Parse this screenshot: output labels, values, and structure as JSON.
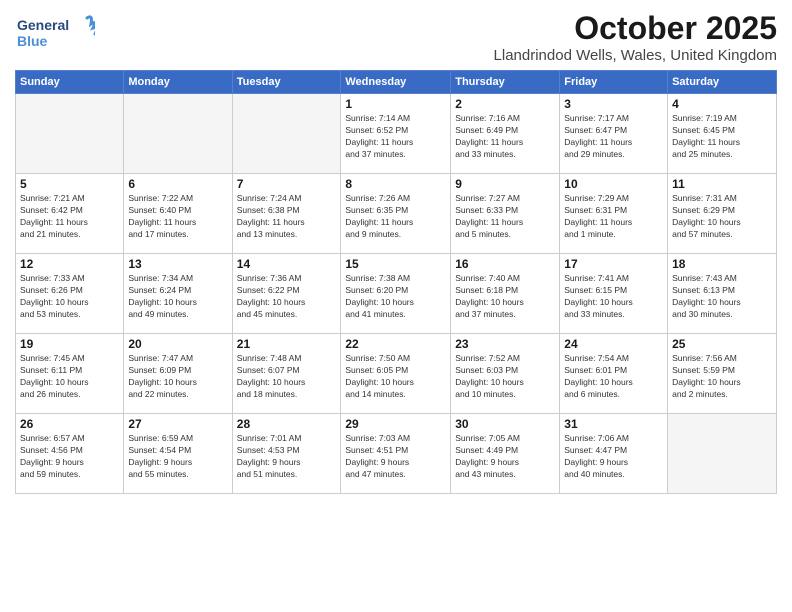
{
  "header": {
    "logo_general": "General",
    "logo_blue": "Blue",
    "month_year": "October 2025",
    "location": "Llandrindod Wells, Wales, United Kingdom"
  },
  "weekdays": [
    "Sunday",
    "Monday",
    "Tuesday",
    "Wednesday",
    "Thursday",
    "Friday",
    "Saturday"
  ],
  "weeks": [
    [
      {
        "day": "",
        "info": ""
      },
      {
        "day": "",
        "info": ""
      },
      {
        "day": "",
        "info": ""
      },
      {
        "day": "1",
        "info": "Sunrise: 7:14 AM\nSunset: 6:52 PM\nDaylight: 11 hours\nand 37 minutes."
      },
      {
        "day": "2",
        "info": "Sunrise: 7:16 AM\nSunset: 6:49 PM\nDaylight: 11 hours\nand 33 minutes."
      },
      {
        "day": "3",
        "info": "Sunrise: 7:17 AM\nSunset: 6:47 PM\nDaylight: 11 hours\nand 29 minutes."
      },
      {
        "day": "4",
        "info": "Sunrise: 7:19 AM\nSunset: 6:45 PM\nDaylight: 11 hours\nand 25 minutes."
      }
    ],
    [
      {
        "day": "5",
        "info": "Sunrise: 7:21 AM\nSunset: 6:42 PM\nDaylight: 11 hours\nand 21 minutes."
      },
      {
        "day": "6",
        "info": "Sunrise: 7:22 AM\nSunset: 6:40 PM\nDaylight: 11 hours\nand 17 minutes."
      },
      {
        "day": "7",
        "info": "Sunrise: 7:24 AM\nSunset: 6:38 PM\nDaylight: 11 hours\nand 13 minutes."
      },
      {
        "day": "8",
        "info": "Sunrise: 7:26 AM\nSunset: 6:35 PM\nDaylight: 11 hours\nand 9 minutes."
      },
      {
        "day": "9",
        "info": "Sunrise: 7:27 AM\nSunset: 6:33 PM\nDaylight: 11 hours\nand 5 minutes."
      },
      {
        "day": "10",
        "info": "Sunrise: 7:29 AM\nSunset: 6:31 PM\nDaylight: 11 hours\nand 1 minute."
      },
      {
        "day": "11",
        "info": "Sunrise: 7:31 AM\nSunset: 6:29 PM\nDaylight: 10 hours\nand 57 minutes."
      }
    ],
    [
      {
        "day": "12",
        "info": "Sunrise: 7:33 AM\nSunset: 6:26 PM\nDaylight: 10 hours\nand 53 minutes."
      },
      {
        "day": "13",
        "info": "Sunrise: 7:34 AM\nSunset: 6:24 PM\nDaylight: 10 hours\nand 49 minutes."
      },
      {
        "day": "14",
        "info": "Sunrise: 7:36 AM\nSunset: 6:22 PM\nDaylight: 10 hours\nand 45 minutes."
      },
      {
        "day": "15",
        "info": "Sunrise: 7:38 AM\nSunset: 6:20 PM\nDaylight: 10 hours\nand 41 minutes."
      },
      {
        "day": "16",
        "info": "Sunrise: 7:40 AM\nSunset: 6:18 PM\nDaylight: 10 hours\nand 37 minutes."
      },
      {
        "day": "17",
        "info": "Sunrise: 7:41 AM\nSunset: 6:15 PM\nDaylight: 10 hours\nand 33 minutes."
      },
      {
        "day": "18",
        "info": "Sunrise: 7:43 AM\nSunset: 6:13 PM\nDaylight: 10 hours\nand 30 minutes."
      }
    ],
    [
      {
        "day": "19",
        "info": "Sunrise: 7:45 AM\nSunset: 6:11 PM\nDaylight: 10 hours\nand 26 minutes."
      },
      {
        "day": "20",
        "info": "Sunrise: 7:47 AM\nSunset: 6:09 PM\nDaylight: 10 hours\nand 22 minutes."
      },
      {
        "day": "21",
        "info": "Sunrise: 7:48 AM\nSunset: 6:07 PM\nDaylight: 10 hours\nand 18 minutes."
      },
      {
        "day": "22",
        "info": "Sunrise: 7:50 AM\nSunset: 6:05 PM\nDaylight: 10 hours\nand 14 minutes."
      },
      {
        "day": "23",
        "info": "Sunrise: 7:52 AM\nSunset: 6:03 PM\nDaylight: 10 hours\nand 10 minutes."
      },
      {
        "day": "24",
        "info": "Sunrise: 7:54 AM\nSunset: 6:01 PM\nDaylight: 10 hours\nand 6 minutes."
      },
      {
        "day": "25",
        "info": "Sunrise: 7:56 AM\nSunset: 5:59 PM\nDaylight: 10 hours\nand 2 minutes."
      }
    ],
    [
      {
        "day": "26",
        "info": "Sunrise: 6:57 AM\nSunset: 4:56 PM\nDaylight: 9 hours\nand 59 minutes."
      },
      {
        "day": "27",
        "info": "Sunrise: 6:59 AM\nSunset: 4:54 PM\nDaylight: 9 hours\nand 55 minutes."
      },
      {
        "day": "28",
        "info": "Sunrise: 7:01 AM\nSunset: 4:53 PM\nDaylight: 9 hours\nand 51 minutes."
      },
      {
        "day": "29",
        "info": "Sunrise: 7:03 AM\nSunset: 4:51 PM\nDaylight: 9 hours\nand 47 minutes."
      },
      {
        "day": "30",
        "info": "Sunrise: 7:05 AM\nSunset: 4:49 PM\nDaylight: 9 hours\nand 43 minutes."
      },
      {
        "day": "31",
        "info": "Sunrise: 7:06 AM\nSunset: 4:47 PM\nDaylight: 9 hours\nand 40 minutes."
      },
      {
        "day": "",
        "info": ""
      }
    ]
  ]
}
